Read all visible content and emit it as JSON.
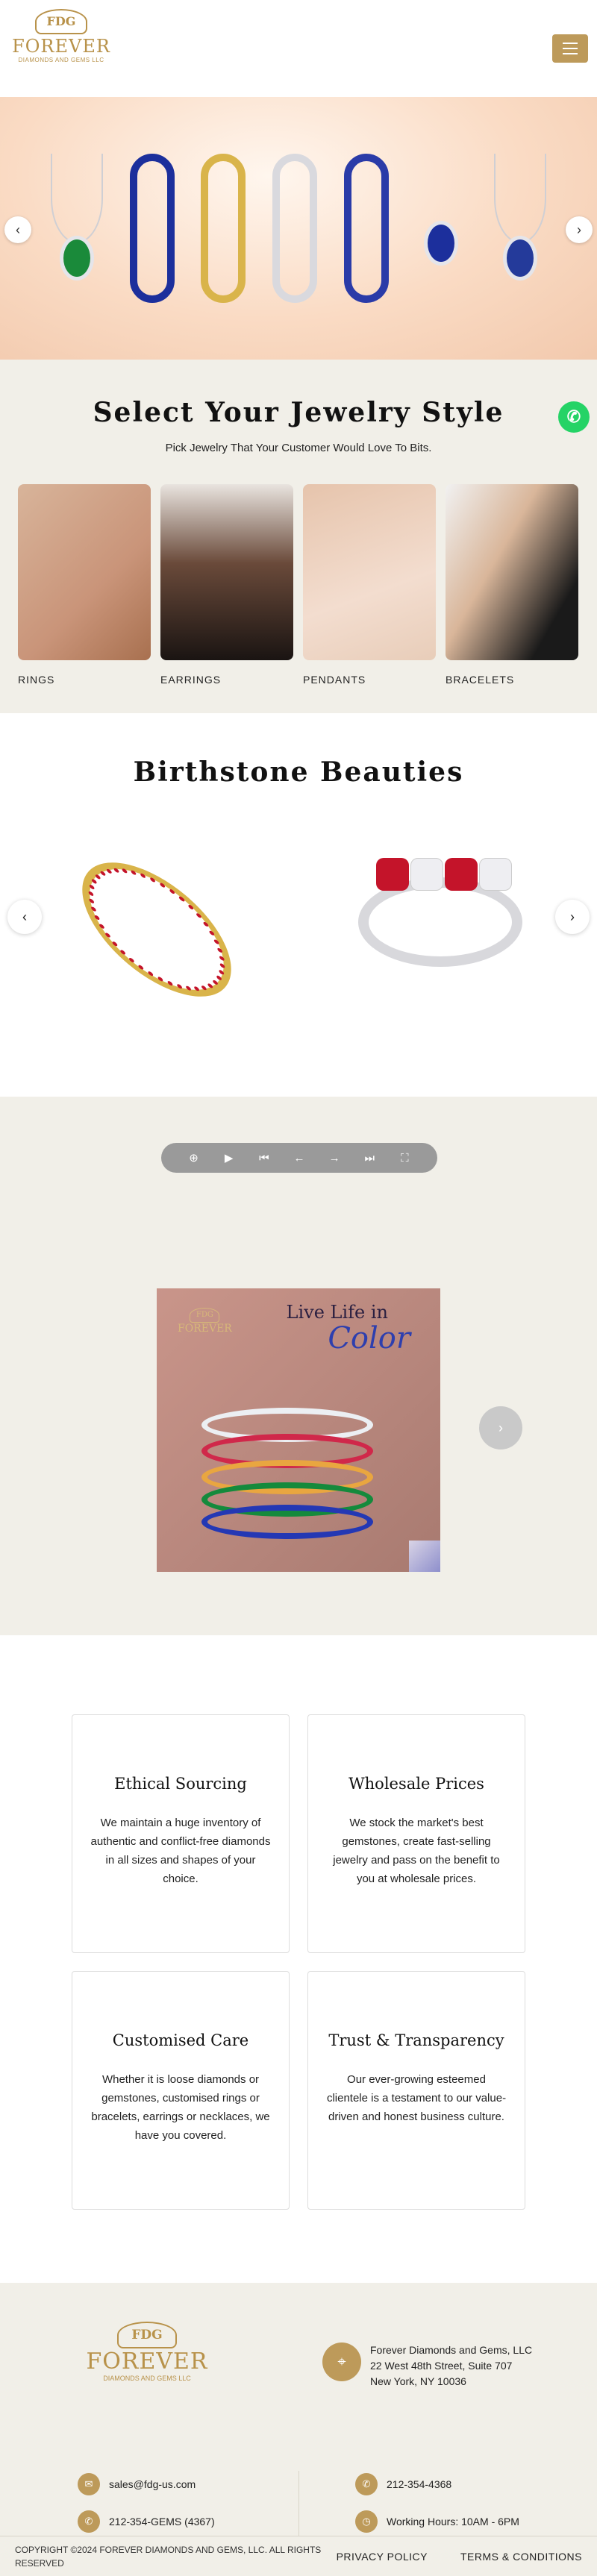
{
  "header": {
    "logo_badge": "FDG",
    "logo_name": "FOREVER",
    "logo_sub": "DIAMONDS AND GEMS LLC"
  },
  "hero": {
    "prev_arrow": "‹",
    "next_arrow": "›",
    "colors": {
      "emerald": "#1a8a3a",
      "sapphire": "#1c2f9c",
      "ruby": "#c4142a",
      "gold": "#d9b44a"
    }
  },
  "style_section": {
    "title": "Select Your Jewelry Style",
    "subtitle": "Pick Jewelry That Your Customer Would Love To Bits.",
    "categories": [
      {
        "label": "RINGS"
      },
      {
        "label": "EARRINGS"
      },
      {
        "label": "PENDANTS"
      },
      {
        "label": "BRACELETS"
      }
    ]
  },
  "birthstone": {
    "title": "Birthstone Beauties",
    "prev_arrow": "‹",
    "next_arrow": "›"
  },
  "gallery": {
    "toolbar": {
      "zoom": "⊕",
      "play": "▶",
      "first": "⏮",
      "prev": "←",
      "next": "→",
      "last": "⏭",
      "fullscreen": "⛶"
    },
    "image": {
      "logo_badge": "FDG",
      "logo_name": "FOREVER",
      "tagline_1": "Live Life in",
      "tagline_2": "Color"
    },
    "next_button": "›"
  },
  "features": [
    {
      "title": "Ethical Sourcing",
      "text": "We maintain a huge inventory of authentic and conflict-free diamonds in all sizes and shapes of your choice."
    },
    {
      "title": "Wholesale Prices",
      "text": "We stock the market's best gemstones, create fast-selling jewelry and pass on the benefit to you at wholesale prices."
    },
    {
      "title": "Customised Care",
      "text": "Whether it is loose diamonds or gemstones, customised rings or bracelets, earrings or necklaces, we have you covered."
    },
    {
      "title": "Trust & Transparency",
      "text": "Our ever-growing esteemed clientele is a testament to our value-driven and honest business culture."
    }
  ],
  "footer": {
    "logo_badge": "FDG",
    "logo_name": "FOREVER",
    "logo_sub": "DIAMONDS AND GEMS LLC",
    "address_line_1": "Forever Diamonds and Gems, LLC",
    "address_line_2": "22 West 48th Street, Suite 707",
    "address_line_3": "New York, NY 10036",
    "email": "sales@fdg-us.com",
    "phone_1": "212-354-4368",
    "phone_2": "212-354-GEMS (4367)",
    "hours": "Working Hours: 10AM - 6PM",
    "copyright": "COPYRIGHT ©2024 FOREVER DIAMONDS AND GEMS, LLC. ALL RIGHTS RESERVED",
    "privacy": "PRIVACY POLICY",
    "terms": "TERMS & CONDITIONS"
  }
}
